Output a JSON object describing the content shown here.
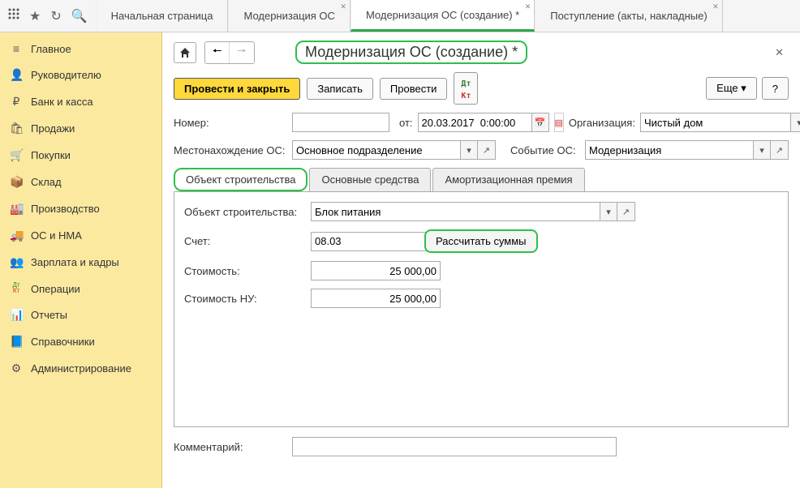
{
  "top_tabs": [
    {
      "label": "Начальная страница",
      "closeable": false,
      "active": false
    },
    {
      "label": "Модернизация ОС",
      "closeable": true,
      "active": false
    },
    {
      "label": "Модернизация ОС (создание) *",
      "closeable": true,
      "active": true
    },
    {
      "label": "Поступление (акты, накладные)",
      "closeable": true,
      "active": false
    }
  ],
  "sidebar": [
    {
      "icon": "≡",
      "label": "Главное"
    },
    {
      "icon": "👤",
      "label": "Руководителю"
    },
    {
      "icon": "₽",
      "label": "Банк и касса"
    },
    {
      "icon": "🛍",
      "label": "Продажи"
    },
    {
      "icon": "🛒",
      "label": "Покупки"
    },
    {
      "icon": "📦",
      "label": "Склад"
    },
    {
      "icon": "🏭",
      "label": "Производство"
    },
    {
      "icon": "🚚",
      "label": "ОС и НМА"
    },
    {
      "icon": "👥",
      "label": "Зарплата и кадры"
    },
    {
      "icon": "ДтКт",
      "label": "Операции"
    },
    {
      "icon": "📊",
      "label": "Отчеты"
    },
    {
      "icon": "📘",
      "label": "Справочники"
    },
    {
      "icon": "⚙",
      "label": "Администрирование"
    }
  ],
  "page_title": "Модернизация ОС (создание) *",
  "toolbar": {
    "post_close": "Провести и закрыть",
    "save": "Записать",
    "post": "Провести",
    "more": "Еще",
    "help": "?"
  },
  "labels": {
    "number": "Номер:",
    "from": "от:",
    "org": "Организация:",
    "location": "Местонахождение ОС:",
    "event": "Событие ОС:",
    "object": "Объект строительства:",
    "account": "Счет:",
    "calc": "Рассчитать суммы",
    "cost": "Стоимость:",
    "cost_nu": "Стоимость НУ:",
    "comment": "Комментарий:"
  },
  "fields": {
    "number": "",
    "date": "20.03.2017  0:00:00",
    "org": "Чистый дом",
    "location": "Основное подразделение",
    "event": "Модернизация",
    "object": "Блок питания",
    "account": "08.03",
    "cost": "25 000,00",
    "cost_nu": "25 000,00",
    "comment": ""
  },
  "inner_tabs": [
    {
      "label": "Объект строительства",
      "active": true,
      "highlight": true
    },
    {
      "label": "Основные средства",
      "active": false
    },
    {
      "label": "Амортизационная премия",
      "active": false
    }
  ]
}
